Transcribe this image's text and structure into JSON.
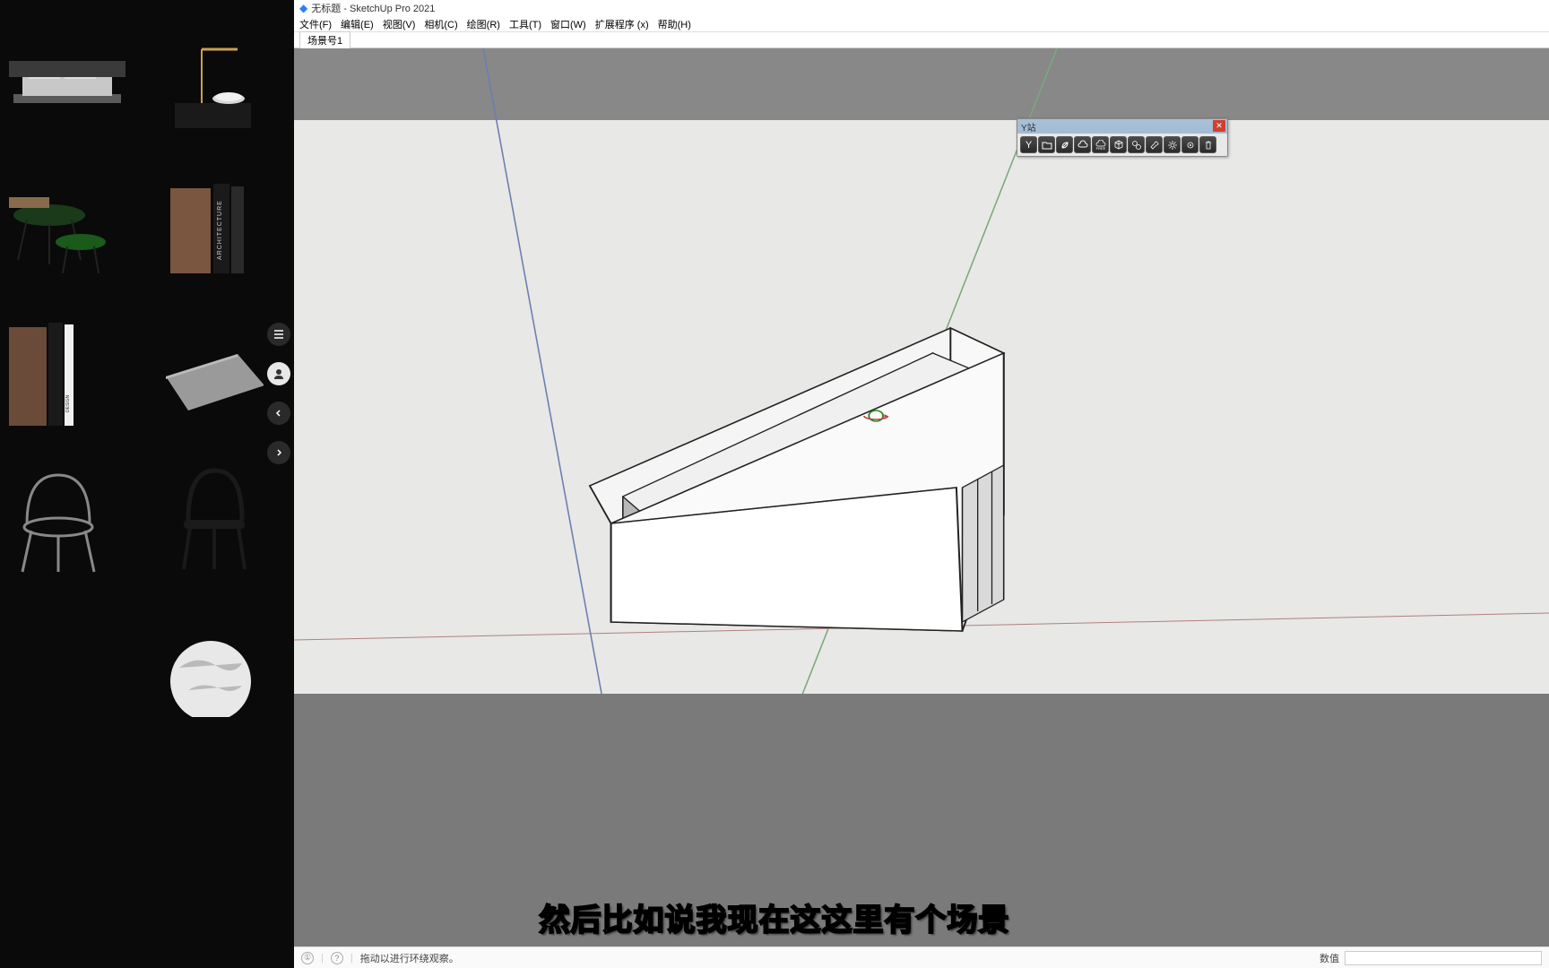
{
  "window": {
    "title": "无标题 - SketchUp Pro 2021"
  },
  "menu": {
    "file": "文件(F)",
    "edit": "编辑(E)",
    "view": "视图(V)",
    "camera": "相机(C)",
    "draw": "绘图(R)",
    "tools": "工具(T)",
    "window": "窗口(W)",
    "extensions": "扩展程序 (x)",
    "help": "帮助(H)"
  },
  "scene": {
    "tab1": "场景号1"
  },
  "toolbar": {
    "title": "Y站"
  },
  "status": {
    "hint": "拖动以进行环绕观察。",
    "value_label": "数值"
  },
  "subtitle": {
    "text": "然后比如说我现在这这里有个场景"
  },
  "icons": {
    "list": "list-icon",
    "avatar": "avatar-icon",
    "prev": "chevron-left-icon",
    "next": "chevron-right-icon",
    "close": "close-icon",
    "y": "y-icon",
    "folder": "folder-icon",
    "leaf": "leaf-icon",
    "cloud": "cloud-icon",
    "cloud-free": "cloud-free-icon",
    "cube": "cube-icon",
    "group": "group-icon",
    "wrench": "wrench-icon",
    "gear": "gear-icon",
    "settings": "settings-icon",
    "trash": "trash-icon",
    "info-left": "info-icon",
    "help-left": "help-icon"
  }
}
